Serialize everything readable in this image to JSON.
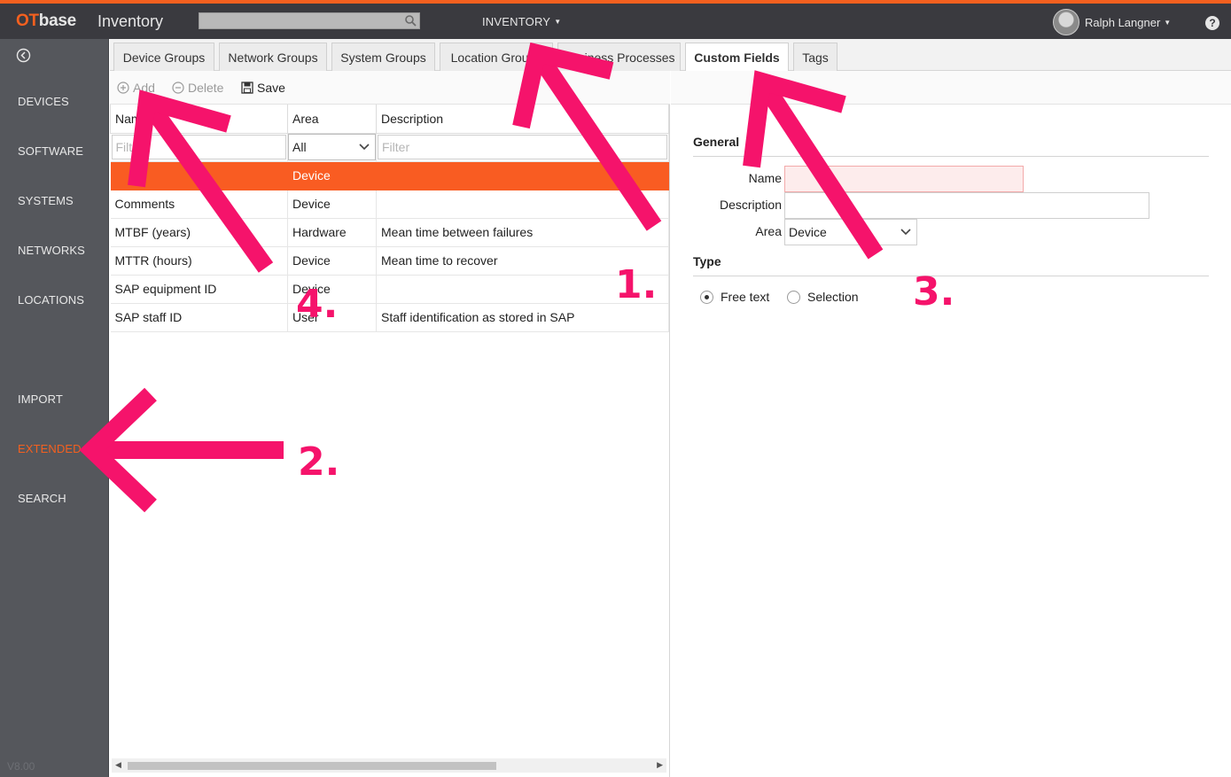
{
  "app": {
    "logo_ot": "OT",
    "logo_base": "base",
    "title": "Inventory",
    "menu_label": "INVENTORY",
    "user_name": "Ralph Langner",
    "help_label": "?",
    "version": "V8.00",
    "accent_color": "#f4601f"
  },
  "sidebar": {
    "items": [
      {
        "label": "DEVICES"
      },
      {
        "label": "SOFTWARE"
      },
      {
        "label": "SYSTEMS"
      },
      {
        "label": "NETWORKS"
      },
      {
        "label": "LOCATIONS"
      },
      {
        "label": "IMPORT"
      },
      {
        "label": "EXTENDED",
        "active": true
      },
      {
        "label": "SEARCH"
      }
    ]
  },
  "tabs": [
    {
      "label": "Device Groups"
    },
    {
      "label": "Network Groups"
    },
    {
      "label": "System Groups"
    },
    {
      "label": "Location Groups"
    },
    {
      "label": "Business Processes"
    },
    {
      "label": "Custom Fields",
      "active": true
    },
    {
      "label": "Tags"
    }
  ],
  "toolbar": {
    "add_label": "Add",
    "delete_label": "Delete",
    "save_label": "Save"
  },
  "grid": {
    "columns": [
      "Name",
      "Area",
      "Description"
    ],
    "filter_placeholder": "Filter",
    "area_filter_value": "All",
    "rows": [
      {
        "name": "",
        "area": "Device",
        "description": "",
        "selected": true
      },
      {
        "name": "Comments",
        "area": "Device",
        "description": ""
      },
      {
        "name": "MTBF (years)",
        "area": "Hardware",
        "description": "Mean time between failures"
      },
      {
        "name": "MTTR (hours)",
        "area": "Device",
        "description": "Mean time to recover"
      },
      {
        "name": "SAP equipment ID",
        "area": "Device",
        "description": ""
      },
      {
        "name": "SAP staff ID",
        "area": "User",
        "description": "Staff identification as stored in SAP"
      }
    ]
  },
  "form": {
    "general_title": "General",
    "name_label": "Name",
    "name_value": "",
    "description_label": "Description",
    "description_value": "",
    "area_label": "Area",
    "area_value": "Device",
    "type_title": "Type",
    "type_options": [
      "Free text",
      "Selection"
    ],
    "type_selected": "Free text"
  },
  "annotations": {
    "labels": [
      "1.",
      "2.",
      "3.",
      "4."
    ],
    "color": "#f5136b"
  }
}
